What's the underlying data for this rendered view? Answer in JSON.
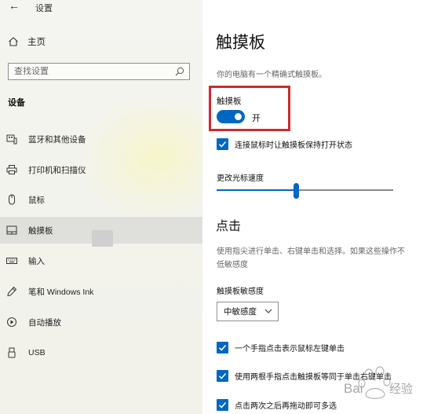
{
  "window": {
    "app_title": "设置"
  },
  "sidebar": {
    "home_label": "主页",
    "search_placeholder": "查找设置",
    "section_title": "设备",
    "items": [
      {
        "label": "蓝牙和其他设备",
        "icon": "bluetooth-devices-icon",
        "selected": false
      },
      {
        "label": "打印机和扫描仪",
        "icon": "printer-icon",
        "selected": false
      },
      {
        "label": "鼠标",
        "icon": "mouse-icon",
        "selected": false
      },
      {
        "label": "触摸板",
        "icon": "touchpad-icon",
        "selected": true
      },
      {
        "label": "输入",
        "icon": "keyboard-icon",
        "selected": false
      },
      {
        "label": "笔和 Windows Ink",
        "icon": "pen-icon",
        "selected": false
      },
      {
        "label": "自动播放",
        "icon": "autoplay-icon",
        "selected": false
      },
      {
        "label": "USB",
        "icon": "usb-icon",
        "selected": false
      }
    ]
  },
  "main": {
    "title": "触摸板",
    "subtitle": "你的电脑有一个精确式触摸板。",
    "touchpad_toggle": {
      "label": "触摸板",
      "state_text": "开",
      "on": true
    },
    "keep_on_checkbox": {
      "label": "连接鼠标时让触摸板保持打开状态",
      "checked": true
    },
    "cursor_speed": {
      "label": "更改光标速度",
      "value_fraction": 0.45
    },
    "taps": {
      "heading": "点击",
      "description_line1": "使用指尖进行单击、右键单击和选择。如果这些操作不",
      "description_line2": "低敏感度",
      "sensitivity_label": "触摸板敏感度",
      "sensitivity_value": "中敏感度",
      "checkboxes": [
        {
          "label": "一个手指点击表示鼠标左键单击",
          "checked": true
        },
        {
          "label": "使用两根手指点击触摸板等同于单击右键单击",
          "checked": true
        },
        {
          "label": "点击两次之后再拖动即可多选",
          "checked": true
        }
      ]
    }
  },
  "colors": {
    "accent": "#0067c0",
    "highlight_border": "#cc2b2b"
  },
  "watermark": {
    "text": "Bai经验"
  }
}
